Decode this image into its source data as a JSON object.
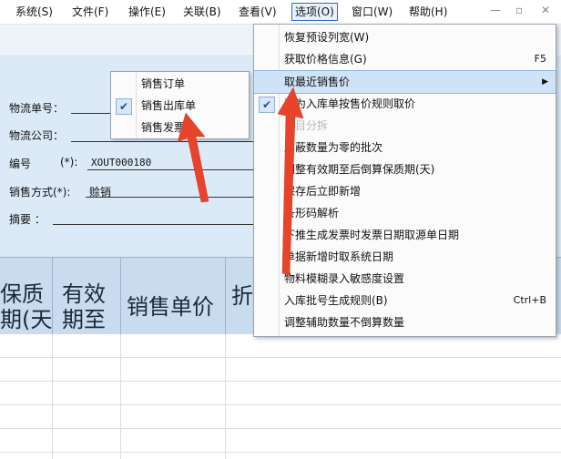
{
  "menubar": {
    "items": [
      "系统(S)",
      "文件(F)",
      "操作(E)",
      "关联(B)",
      "查看(V)",
      "选项(O)",
      "窗口(W)",
      "帮助(H)"
    ],
    "active_index": 5,
    "window_buttons": [
      "—",
      "▫",
      "✕"
    ]
  },
  "form": {
    "logistics_no_label": "物流单号：",
    "logistics_co_label": "物流公司：",
    "code_label": "编号",
    "code_required": "(*):",
    "code_value": "XOUT000180",
    "sale_method_label": "销售方式(*):",
    "sale_method_value": "赊销",
    "summary_label": "摘要 ："
  },
  "grid": {
    "columns": [
      "保质\n期(天",
      "有效\n期至",
      "销售单价",
      "折"
    ]
  },
  "options_menu": {
    "items": [
      {
        "label": "恢复预设列宽(W)",
        "checked": false,
        "disabled": false,
        "shortcut": "",
        "submenu": false
      },
      {
        "label": "获取价格信息(G)",
        "checked": false,
        "disabled": false,
        "shortcut": "F5",
        "submenu": false
      },
      {
        "label": "取最近销售价",
        "checked": false,
        "disabled": false,
        "shortcut": "",
        "submenu": true,
        "highlighted": true
      },
      {
        "label": "退为入库单按售价规则取价",
        "checked": true,
        "disabled": false,
        "shortcut": "",
        "submenu": false
      },
      {
        "label": "条目分拆",
        "checked": false,
        "disabled": true,
        "shortcut": "",
        "submenu": false
      },
      {
        "label": "屏蔽数量为零的批次",
        "checked": false,
        "disabled": false,
        "shortcut": "",
        "submenu": false
      },
      {
        "label": "调整有效期至后倒算保质期(天)",
        "checked": false,
        "disabled": false,
        "shortcut": "",
        "submenu": false
      },
      {
        "label": "保存后立即新增",
        "checked": false,
        "disabled": false,
        "shortcut": "",
        "submenu": false
      },
      {
        "label": "条形码解析",
        "checked": false,
        "disabled": false,
        "shortcut": "",
        "submenu": false
      },
      {
        "label": "下推生成发票时发票日期取源单日期",
        "checked": false,
        "disabled": false,
        "shortcut": "",
        "submenu": false
      },
      {
        "label": "单据新增时取系统日期",
        "checked": false,
        "disabled": false,
        "shortcut": "",
        "submenu": false
      },
      {
        "label": "物料模糊录入敏感度设置",
        "checked": false,
        "disabled": false,
        "shortcut": "",
        "submenu": false
      },
      {
        "label": "入库批号生成规则(B)",
        "checked": false,
        "disabled": false,
        "shortcut": "Ctrl+B",
        "submenu": false
      },
      {
        "label": "调整辅助数量不倒算数量",
        "checked": false,
        "disabled": false,
        "shortcut": "",
        "submenu": false
      }
    ]
  },
  "submenu": {
    "items": [
      {
        "label": "销售订单",
        "checked": false
      },
      {
        "label": "销售出库单",
        "checked": true
      },
      {
        "label": "销售发票",
        "checked": false
      }
    ]
  },
  "colors": {
    "highlight": "#cfe3f8",
    "form_band": "#dceaf7",
    "arrow": "#e8442c"
  },
  "icons": {
    "check": "✔",
    "submenu_arrow": "▶"
  }
}
